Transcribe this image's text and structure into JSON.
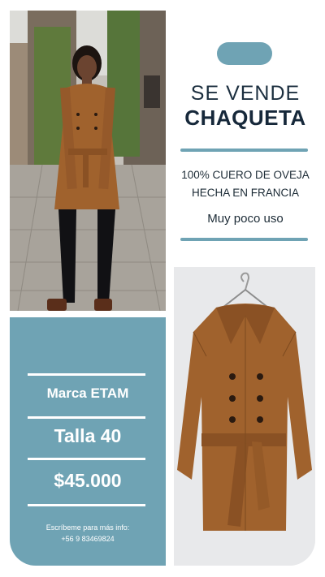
{
  "headline": {
    "line1": "SE VENDE",
    "line2": "CHAQUETA"
  },
  "description": {
    "line1": "100% CUERO DE OVEJA",
    "line2": "HECHA EN FRANCIA",
    "usage": "Muy poco uso"
  },
  "card": {
    "brand": "Marca ETAM",
    "size": "Talla 40",
    "price": "$45.000",
    "contact_label": "Escríbeme para más info:",
    "phone": "+56 9 83469824"
  },
  "colors": {
    "accent": "#6fa3b4",
    "title": "#16283a",
    "card_text": "#ffffff",
    "jacket": "#a0622d"
  },
  "images": {
    "woman_photo": "woman-in-brown-trench-coat-photo",
    "jacket_photo": "brown-leather-jacket-on-hanger-photo"
  }
}
